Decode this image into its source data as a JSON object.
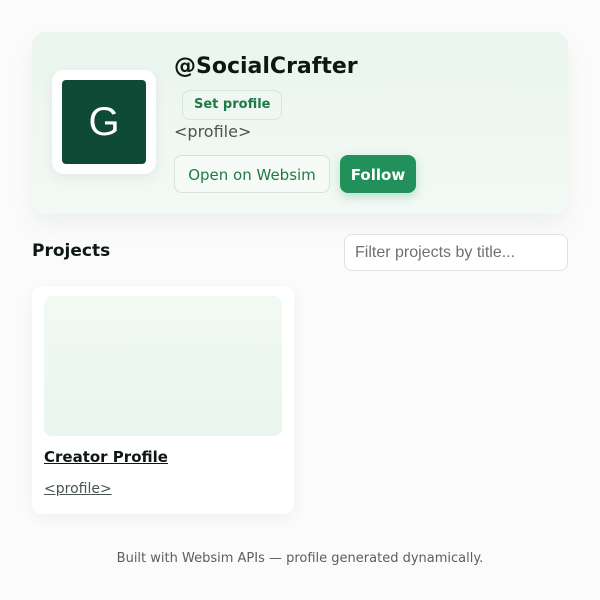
{
  "profile": {
    "avatar_letter": "G",
    "avatar_color": "#0f4a36",
    "username": "@SocialCrafter",
    "set_profile_label": "Set profile",
    "tag": "<profile>",
    "open_button_label": "Open on Websim",
    "follow_button_label": "Follow"
  },
  "projects": {
    "title": "Projects",
    "filter_placeholder": "Filter projects by title...",
    "items": [
      {
        "title": "Creator Profile",
        "link_text": "<profile>"
      }
    ]
  },
  "footer": {
    "text": "Built with Websim APIs — profile generated dynamically."
  },
  "colors": {
    "accent": "#22905a",
    "accent_text": "#1f7a47",
    "card_background": "#eaf5ee"
  }
}
